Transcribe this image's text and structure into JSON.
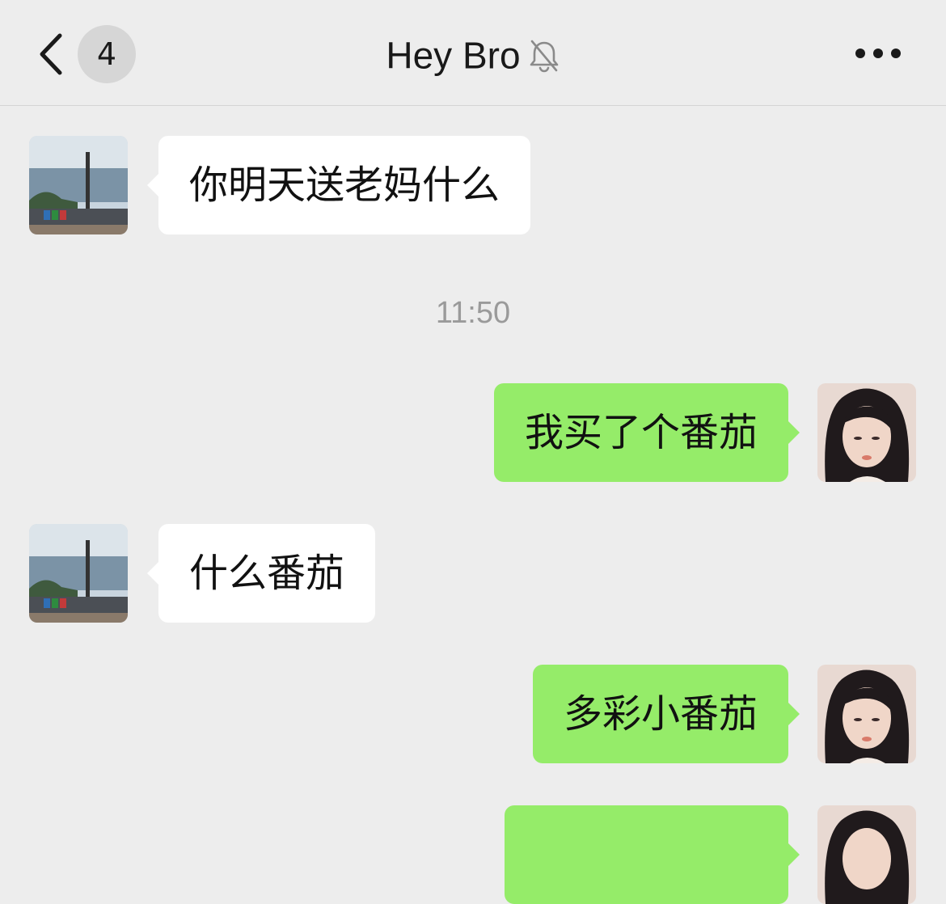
{
  "header": {
    "unread_count": "4",
    "title": "Hey Bro",
    "back_icon": "chevron-left-icon",
    "mute_icon": "bell-slash-icon",
    "more_icon": "more-dots-icon"
  },
  "messages": [
    {
      "side": "in",
      "text": "你明天送老妈什么"
    },
    {
      "type": "timestamp",
      "text": "11:50"
    },
    {
      "side": "out",
      "text": "我买了个番茄"
    },
    {
      "side": "in",
      "text": "什么番茄"
    },
    {
      "side": "out",
      "text": "多彩小番茄"
    },
    {
      "side": "out",
      "text": ""
    }
  ],
  "colors": {
    "background": "#ededed",
    "incoming_bubble": "#ffffff",
    "outgoing_bubble": "#95ec69",
    "timestamp_text": "#9a9a9a"
  }
}
